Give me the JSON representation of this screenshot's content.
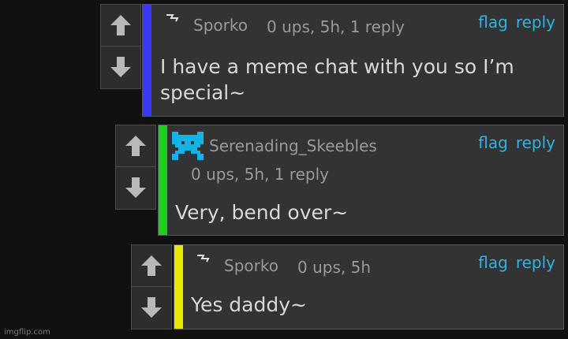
{
  "comments": [
    {
      "username": "Sporko",
      "meta": "0 ups, 5h, 1 reply",
      "flag": "flag",
      "reply": "reply",
      "text": "I have a meme chat with you so I’m special~",
      "stripe_color": "#3a3af5",
      "avatar_icon": "lightning-bolt-icon"
    },
    {
      "username": "Serenading_Skeebles",
      "meta": "0 ups, 5h, 1 reply",
      "flag": "flag",
      "reply": "reply",
      "text": "Very, bend over~",
      "stripe_color": "#22cc22",
      "avatar_icon": "pixel-creature-icon",
      "avatar_color": "#12b4e8"
    },
    {
      "username": "Sporko",
      "meta": "0 ups, 5h",
      "flag": "flag",
      "reply": "reply",
      "text": "Yes daddy~",
      "stripe_color": "#e8e800",
      "avatar_icon": "lightning-bolt-icon"
    }
  ],
  "watermark": "imgflip.com",
  "colors": {
    "background": "#111111",
    "card": "#333333",
    "link": "#2fb3e0",
    "vote_arrow": "#b9b9b9"
  }
}
